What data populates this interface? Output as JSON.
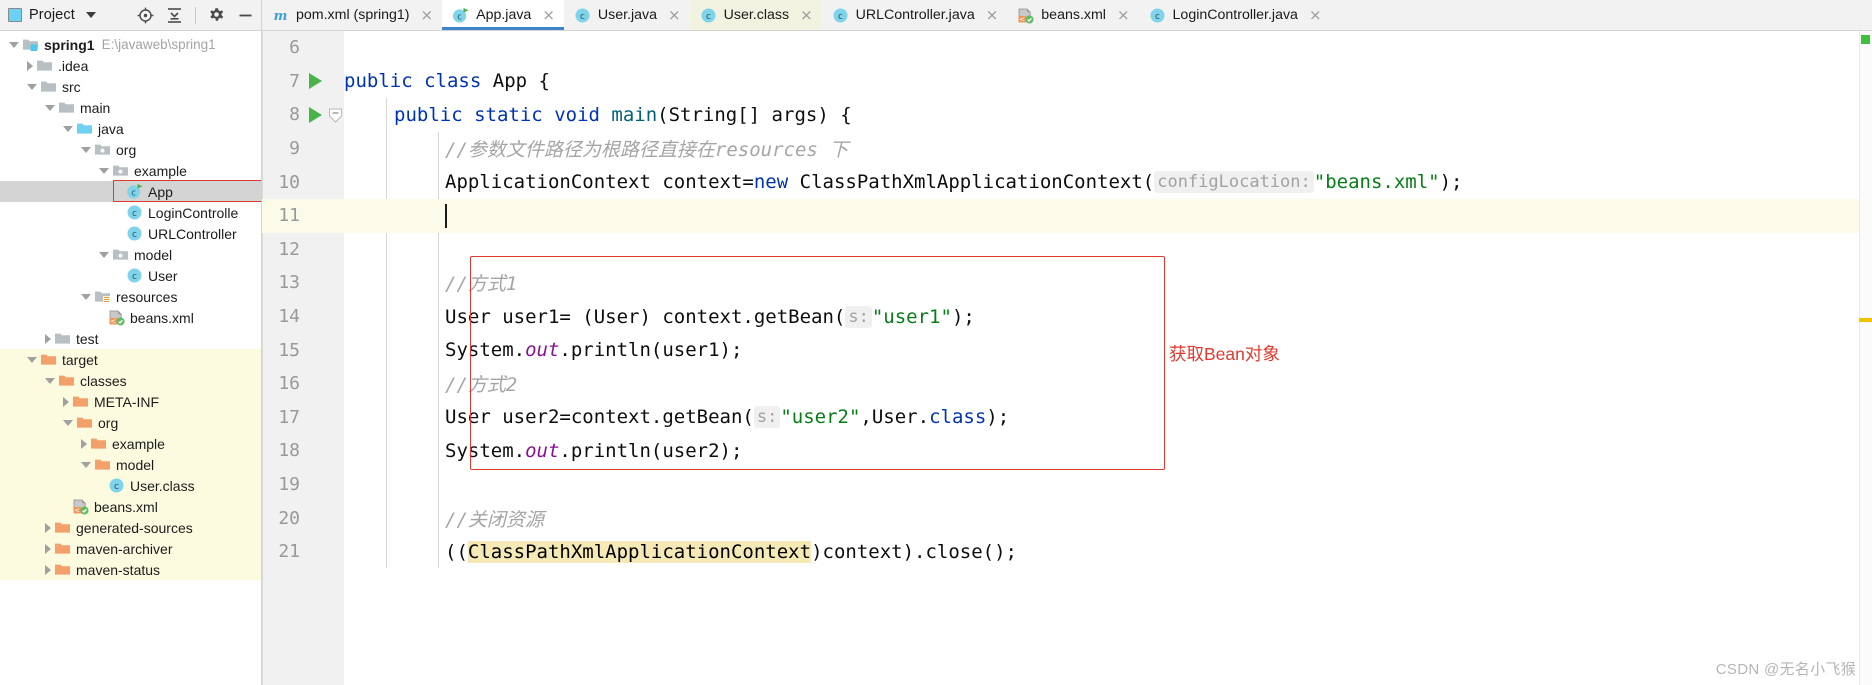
{
  "toolbar": {
    "project_label": "Project",
    "icons": [
      "locate-icon",
      "collapse-all-icon",
      "settings-icon",
      "minimize-icon"
    ]
  },
  "tabs": [
    {
      "label": "pom.xml (spring1)",
      "icon": "maven-icon",
      "state": "normal",
      "close": "×"
    },
    {
      "label": "App.java",
      "icon": "java-run-class-icon",
      "state": "active",
      "close": "×"
    },
    {
      "label": "User.java",
      "icon": "java-class-icon",
      "state": "normal",
      "close": "×"
    },
    {
      "label": "User.class",
      "icon": "java-class-icon",
      "state": "tinted",
      "close": "×"
    },
    {
      "label": "URLController.java",
      "icon": "java-class-icon",
      "state": "normal",
      "close": "×"
    },
    {
      "label": "beans.xml",
      "icon": "spring-xml-icon",
      "state": "normal",
      "close": "×"
    },
    {
      "label": "LoginController.java",
      "icon": "java-class-icon",
      "state": "normal",
      "close": "×"
    }
  ],
  "tree": [
    {
      "label": "spring1",
      "path": "E:\\javaweb\\spring1",
      "indent": 0,
      "arrow": "open",
      "icon": "module-folder-icon",
      "bold": true,
      "state": "normal"
    },
    {
      "label": ".idea",
      "path": "",
      "indent": 1,
      "arrow": "closed",
      "icon": "folder-icon",
      "bold": false,
      "state": "normal"
    },
    {
      "label": "src",
      "path": "",
      "indent": 1,
      "arrow": "open",
      "icon": "folder-icon",
      "bold": false,
      "state": "normal"
    },
    {
      "label": "main",
      "path": "",
      "indent": 2,
      "arrow": "open",
      "icon": "folder-icon",
      "bold": false,
      "state": "normal"
    },
    {
      "label": "java",
      "path": "",
      "indent": 3,
      "arrow": "open",
      "icon": "source-folder-icon",
      "bold": false,
      "state": "normal"
    },
    {
      "label": "org",
      "path": "",
      "indent": 4,
      "arrow": "open",
      "icon": "package-icon",
      "bold": false,
      "state": "normal"
    },
    {
      "label": "example",
      "path": "",
      "indent": 5,
      "arrow": "open",
      "icon": "package-icon",
      "bold": false,
      "state": "normal"
    },
    {
      "label": "App",
      "path": "",
      "indent": 6,
      "arrow": "none",
      "icon": "java-run-class-icon",
      "bold": false,
      "state": "selected"
    },
    {
      "label": "LoginControlle",
      "path": "",
      "indent": 6,
      "arrow": "none",
      "icon": "java-class-icon",
      "bold": false,
      "state": "normal"
    },
    {
      "label": "URLController",
      "path": "",
      "indent": 6,
      "arrow": "none",
      "icon": "java-class-icon",
      "bold": false,
      "state": "normal"
    },
    {
      "label": "model",
      "path": "",
      "indent": 5,
      "arrow": "open",
      "icon": "package-icon",
      "bold": false,
      "state": "normal"
    },
    {
      "label": "User",
      "path": "",
      "indent": 6,
      "arrow": "none",
      "icon": "java-class-icon",
      "bold": false,
      "state": "normal"
    },
    {
      "label": "resources",
      "path": "",
      "indent": 4,
      "arrow": "open",
      "icon": "resources-folder-icon",
      "bold": false,
      "state": "normal"
    },
    {
      "label": "beans.xml",
      "path": "",
      "indent": 5,
      "arrow": "none",
      "icon": "spring-xml-icon",
      "bold": false,
      "state": "normal"
    },
    {
      "label": "test",
      "path": "",
      "indent": 2,
      "arrow": "closed",
      "icon": "folder-icon",
      "bold": false,
      "state": "normal"
    },
    {
      "label": "target",
      "path": "",
      "indent": 1,
      "arrow": "open",
      "icon": "excluded-folder-icon",
      "bold": false,
      "state": "target"
    },
    {
      "label": "classes",
      "path": "",
      "indent": 2,
      "arrow": "open",
      "icon": "excluded-folder-icon",
      "bold": false,
      "state": "target"
    },
    {
      "label": "META-INF",
      "path": "",
      "indent": 3,
      "arrow": "closed",
      "icon": "excluded-folder-icon",
      "bold": false,
      "state": "target"
    },
    {
      "label": "org",
      "path": "",
      "indent": 3,
      "arrow": "open",
      "icon": "excluded-folder-icon",
      "bold": false,
      "state": "target"
    },
    {
      "label": "example",
      "path": "",
      "indent": 4,
      "arrow": "closed",
      "icon": "excluded-folder-icon",
      "bold": false,
      "state": "target"
    },
    {
      "label": "model",
      "path": "",
      "indent": 4,
      "arrow": "open",
      "icon": "excluded-folder-icon",
      "bold": false,
      "state": "target"
    },
    {
      "label": "User.class",
      "path": "",
      "indent": 5,
      "arrow": "none",
      "icon": "java-class-icon",
      "bold": false,
      "state": "target"
    },
    {
      "label": "beans.xml",
      "path": "",
      "indent": 3,
      "arrow": "none",
      "icon": "spring-xml-icon",
      "bold": false,
      "state": "target"
    },
    {
      "label": "generated-sources",
      "path": "",
      "indent": 2,
      "arrow": "closed",
      "icon": "excluded-folder-icon",
      "bold": false,
      "state": "target"
    },
    {
      "label": "maven-archiver",
      "path": "",
      "indent": 2,
      "arrow": "closed",
      "icon": "excluded-folder-icon",
      "bold": false,
      "state": "target"
    },
    {
      "label": "maven-status",
      "path": "",
      "indent": 2,
      "arrow": "closed",
      "icon": "excluded-folder-icon",
      "bold": false,
      "state": "target"
    }
  ],
  "editor": {
    "gutter": [
      {
        "num": "6",
        "run": false,
        "fold": false
      },
      {
        "num": "7",
        "run": true,
        "fold": false
      },
      {
        "num": "8",
        "run": true,
        "fold": true
      },
      {
        "num": "9",
        "run": false,
        "fold": false
      },
      {
        "num": "10",
        "run": false,
        "fold": false
      },
      {
        "num": "11",
        "run": false,
        "fold": false
      },
      {
        "num": "12",
        "run": false,
        "fold": false
      },
      {
        "num": "13",
        "run": false,
        "fold": false
      },
      {
        "num": "14",
        "run": false,
        "fold": false
      },
      {
        "num": "15",
        "run": false,
        "fold": false
      },
      {
        "num": "16",
        "run": false,
        "fold": false
      },
      {
        "num": "17",
        "run": false,
        "fold": false
      },
      {
        "num": "18",
        "run": false,
        "fold": false
      },
      {
        "num": "19",
        "run": false,
        "fold": false
      },
      {
        "num": "20",
        "run": false,
        "fold": false
      },
      {
        "num": "21",
        "run": false,
        "fold": false
      }
    ],
    "code": {
      "l6": "",
      "l7_kw1": "public",
      "l7_kw2": "class",
      "l7_name": "App",
      "l7_brace": "{",
      "l8_kw1": "public",
      "l8_kw2": "static",
      "l8_kw3": "void",
      "l8_mth": "main",
      "l8_rest": "(String[] args) {",
      "l9_comment": "//参数文件路径为根路径直接在resources 下",
      "l10_a": "ApplicationContext context=",
      "l10_new": "new",
      "l10_b": " ClassPathXmlApplicationContext(",
      "l10_hint": "configLocation:",
      "l10_str": "\"beans.xml\"",
      "l10_c": ");",
      "l13_comment": "//方式1",
      "l14_a": "User user1= (User) context.getBean(",
      "l14_hint": "s:",
      "l14_str": "\"user1\"",
      "l14_b": ");",
      "l15_a": "System.",
      "l15_fld": "out",
      "l15_b": ".println(user1);",
      "l16_comment": "//方式2",
      "l17_a": "User user2=context.getBean(",
      "l17_hint": "s:",
      "l17_str": "\"user2\"",
      "l17_b": ",User.",
      "l17_kw": "class",
      "l17_c": ");",
      "l18_a": "System.",
      "l18_fld": "out",
      "l18_b": ".println(user2);",
      "l20_comment": "//关闭资源",
      "l21_a": "((",
      "l21_hl": "ClassPathXmlApplicationContext",
      "l21_b": ")context).close();"
    },
    "annotation": "获取Bean对象",
    "annotation_color": "#e03a2f",
    "highlight_box_color": "#e03a2f"
  },
  "watermark": "CSDN @无名小飞猴"
}
